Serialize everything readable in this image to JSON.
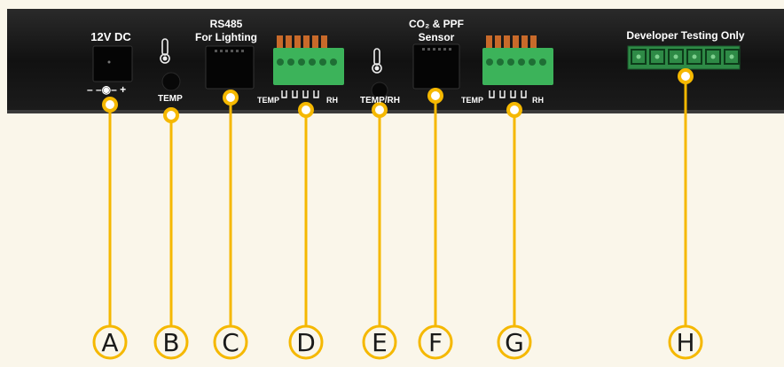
{
  "labels": {
    "dc_jack": "12V DC",
    "polarity": "– –◉– +",
    "temp_b": "TEMP",
    "rs485_line1": "RS485",
    "rs485_line2": "For Lighting",
    "terminal_d_left": "TEMP",
    "terminal_d_right": "RH",
    "temp_rh_e": "TEMP/RH",
    "co2_line1": "CO₂ & PPF",
    "co2_line2": "Sensor",
    "terminal_g_left": "TEMP",
    "terminal_g_right": "RH",
    "developer": "Developer Testing Only"
  },
  "callouts": [
    {
      "letter": "A"
    },
    {
      "letter": "B"
    },
    {
      "letter": "C"
    },
    {
      "letter": "D"
    },
    {
      "letter": "E"
    },
    {
      "letter": "F"
    },
    {
      "letter": "G"
    },
    {
      "letter": "H"
    }
  ],
  "colors": {
    "background": "#faf6ea",
    "panel": "#141414",
    "callout": "#f5b800",
    "terminal_green": "#3cb35a",
    "terminal_orange": "#c86a2a",
    "dev_header": "#2e8a46"
  },
  "icons": {
    "thermometer": "thermometer-icon"
  }
}
